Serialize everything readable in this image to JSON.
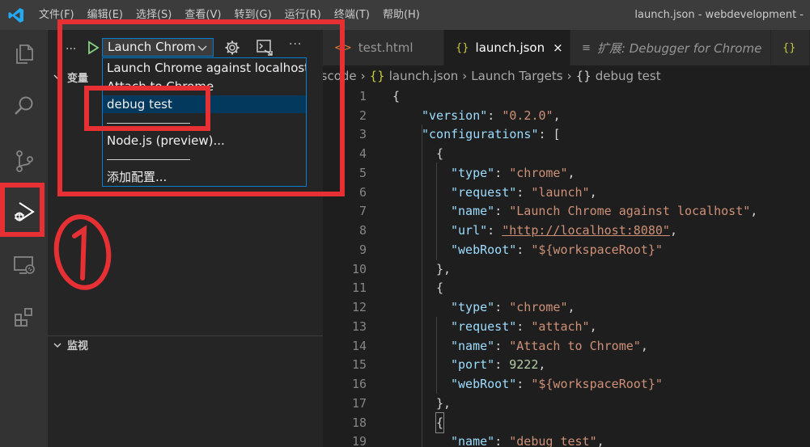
{
  "titlebar": {
    "menu": [
      "文件(F)",
      "编辑(E)",
      "选择(S)",
      "查看(V)",
      "转到(G)",
      "运行(R)",
      "终端(T)",
      "帮助(H)"
    ],
    "window_title": "launch.json - webdevelopment -"
  },
  "activity_bar": {
    "icons": [
      "explorer-icon",
      "search-icon",
      "source-control-icon",
      "run-debug-icon",
      "remote-explorer-icon",
      "extensions-icon"
    ],
    "active": "run-debug-icon"
  },
  "sidebar": {
    "more_left": "...",
    "config_selected": "Launch Chrom",
    "more_right": "···",
    "sections": {
      "variables": "变量",
      "watch": "监视"
    }
  },
  "dropdown": {
    "items": [
      "Launch Chrome against localhost",
      "Attach to Chrome",
      "debug test",
      "Node.js (preview)...",
      "添加配置..."
    ],
    "selected": "debug test"
  },
  "editor": {
    "tabs": [
      {
        "label": "test.html",
        "icon": "<>",
        "state": "inactive"
      },
      {
        "label": "launch.json",
        "icon": "{}",
        "state": "active",
        "close": "×"
      },
      {
        "label": "扩展: Debugger for Chrome",
        "icon": "≡",
        "state": "preview"
      }
    ],
    "breadcrumb": [
      ".vscode",
      "launch.json",
      "Launch Targets",
      "debug test"
    ],
    "line_numbers": [
      1,
      2,
      3,
      4,
      5,
      6,
      7,
      8,
      9,
      10,
      11,
      12,
      13,
      14,
      15,
      16,
      17,
      18,
      19
    ],
    "code": {
      "l1": "{",
      "l2_key": "\"version\"",
      "l2_val": "\"0.2.0\"",
      "l3_key": "\"configurations\"",
      "l3_rest": ": [",
      "l4": "{",
      "l5_key": "\"type\"",
      "l5_val": "\"chrome\"",
      "l6_key": "\"request\"",
      "l6_val": "\"launch\"",
      "l7_key": "\"name\"",
      "l7_val": "\"Launch Chrome against localhost\"",
      "l8_key": "\"url\"",
      "l8_val": "\"http://localhost:8080\"",
      "l9_key": "\"webRoot\"",
      "l9_val": "\"${workspaceRoot}\"",
      "l10": "},",
      "l11": "{",
      "l12_key": "\"type\"",
      "l12_val": "\"chrome\"",
      "l13_key": "\"request\"",
      "l13_val": "\"attach\"",
      "l14_key": "\"name\"",
      "l14_val": "\"Attach to Chrome\"",
      "l15_key": "\"port\"",
      "l15_val": "9222",
      "l16_key": "\"webRoot\"",
      "l16_val": "\"${workspaceRoot}\"",
      "l17": "},",
      "l18": "{",
      "l19_key": "\"name\"",
      "l19_val": "\"debug test\""
    }
  },
  "annotations": {
    "color": "#e63034"
  }
}
